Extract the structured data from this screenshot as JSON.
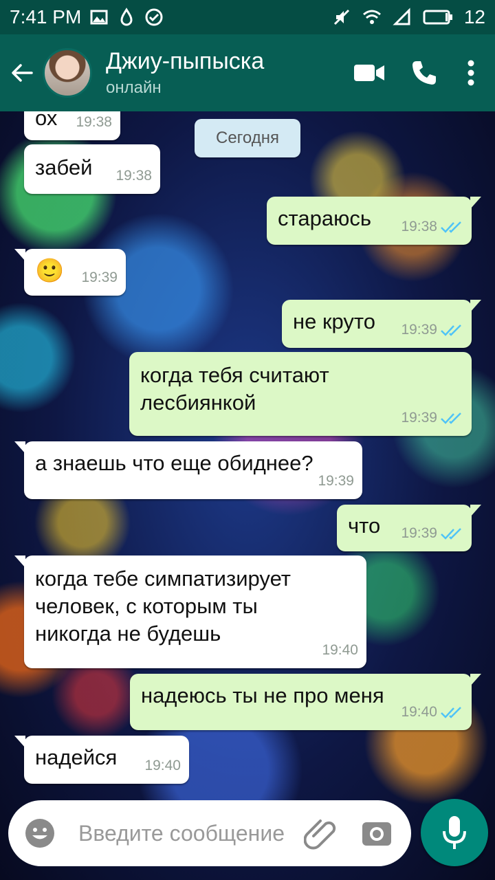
{
  "status_bar": {
    "time": "7:41 PM",
    "battery": "12"
  },
  "header": {
    "contact_name": "Джиу-пыпыска",
    "status": "онлайн"
  },
  "date_divider": "Сегодня",
  "messages": [
    {
      "direction": "in",
      "text": "ох",
      "time": "19:38"
    },
    {
      "direction": "in",
      "text": "забей",
      "time": "19:38"
    },
    {
      "direction": "out",
      "text": "стараюсь",
      "time": "19:38",
      "read": true
    },
    {
      "direction": "in",
      "text": "🙂",
      "time": "19:39"
    },
    {
      "direction": "out",
      "text": "не круто",
      "time": "19:39",
      "read": true
    },
    {
      "direction": "out",
      "text_lines": [
        "когда тебя считают",
        "лесбиянкой"
      ],
      "time": "19:39",
      "read": true
    },
    {
      "direction": "in",
      "text": "а знаешь что еще обиднее?",
      "time": "19:39"
    },
    {
      "direction": "out",
      "text": "что",
      "time": "19:39",
      "read": true
    },
    {
      "direction": "in",
      "text_lines": [
        "когда тебе симпатизирует",
        "человек, с которым ты",
        "никогда не будешь"
      ],
      "time": "19:40"
    },
    {
      "direction": "out",
      "text": "надеюсь ты не про меня",
      "time": "19:40",
      "read": true
    },
    {
      "direction": "in",
      "text": "надейся",
      "time": "19:40"
    }
  ],
  "composer": {
    "placeholder": "Введите сообщение"
  },
  "colors": {
    "header": "#075e54",
    "status_bar": "#054d44",
    "incoming": "#ffffff",
    "outgoing": "#dcf8c6",
    "read_ticks": "#4fc3f7",
    "mic_button": "#00897b"
  }
}
